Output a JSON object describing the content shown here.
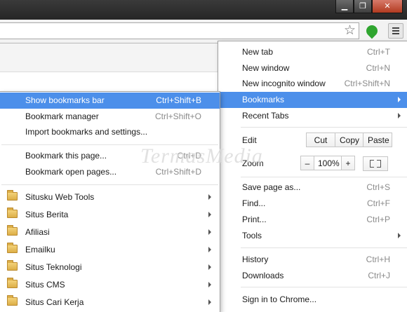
{
  "window": {
    "minimize_glyph": "▁",
    "maximize_glyph": "❐",
    "close_glyph": "✕"
  },
  "toolbar": {
    "bookmark_star_glyph": "☆",
    "extension_icon": "green-leaf-extension-icon",
    "menu_icon": "hamburger-menu-icon"
  },
  "main_menu": {
    "new_tab": {
      "label": "New tab",
      "shortcut": "Ctrl+T"
    },
    "new_window": {
      "label": "New window",
      "shortcut": "Ctrl+N"
    },
    "new_incognito": {
      "label": "New incognito window",
      "shortcut": "Ctrl+Shift+N"
    },
    "bookmarks": {
      "label": "Bookmarks"
    },
    "recent_tabs": {
      "label": "Recent Tabs"
    },
    "edit": {
      "label": "Edit",
      "cut": "Cut",
      "copy": "Copy",
      "paste": "Paste"
    },
    "zoom": {
      "label": "Zoom",
      "minus": "–",
      "value": "100%",
      "plus": "+"
    },
    "save_page": {
      "label": "Save page as...",
      "shortcut": "Ctrl+S"
    },
    "find": {
      "label": "Find...",
      "shortcut": "Ctrl+F"
    },
    "print": {
      "label": "Print...",
      "shortcut": "Ctrl+P"
    },
    "tools": {
      "label": "Tools"
    },
    "history": {
      "label": "History",
      "shortcut": "Ctrl+H"
    },
    "downloads": {
      "label": "Downloads",
      "shortcut": "Ctrl+J"
    },
    "sign_in": {
      "label": "Sign in to Chrome..."
    }
  },
  "bookmarks_menu": {
    "show_bar": {
      "label": "Show bookmarks bar",
      "shortcut": "Ctrl+Shift+B"
    },
    "manager": {
      "label": "Bookmark manager",
      "shortcut": "Ctrl+Shift+O"
    },
    "import": {
      "label": "Import bookmarks and settings..."
    },
    "bookmark_page": {
      "label": "Bookmark this page...",
      "shortcut": "Ctrl+D"
    },
    "bookmark_open": {
      "label": "Bookmark open pages...",
      "shortcut": "Ctrl+Shift+D"
    },
    "folders": [
      {
        "label": "Situsku  Web Tools"
      },
      {
        "label": "Situs Berita"
      },
      {
        "label": "Afiliasi"
      },
      {
        "label": "Emailku"
      },
      {
        "label": "Situs Teknologi"
      },
      {
        "label": "Situs CMS"
      },
      {
        "label": "Situs Cari Kerja"
      }
    ]
  },
  "watermark": "TermasMedia",
  "colors": {
    "highlight": "#4c8fea",
    "titlebar": "#262626",
    "close_button": "#b23a20"
  }
}
